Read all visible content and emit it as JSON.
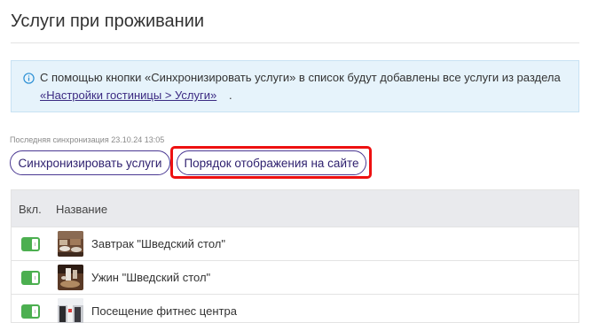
{
  "page": {
    "title": "Услуги при проживании"
  },
  "info": {
    "text": "С помощью кнопки «Синхронизировать услуги» в список будут добавлены все услуги из раздела",
    "link": "«Настройки гостиницы > Услуги»",
    "trailing": ".",
    "icon": "info-circle-icon"
  },
  "sync": {
    "last": "Последняя синхронизация 23.10.24 13:05"
  },
  "buttons": {
    "sync": "Синхронизировать услуги",
    "order": "Порядок отображения на сайте"
  },
  "table": {
    "headers": {
      "enabled": "Вкл.",
      "name": "Название"
    },
    "rows": [
      {
        "name": "Завтрак \"Шведский стол\"",
        "enabled": true,
        "thumbnail": "breakfast-photo"
      },
      {
        "name": "Ужин \"Шведский стол\"",
        "enabled": true,
        "thumbnail": "dinner-photo"
      },
      {
        "name": "Посещение фитнес центра",
        "enabled": true,
        "thumbnail": "fitness-photo"
      }
    ]
  },
  "colors": {
    "accent": "#4a3892",
    "toggle_on": "#4caf50",
    "info_bg": "#e6f3fb",
    "highlight": "#ee1111"
  }
}
